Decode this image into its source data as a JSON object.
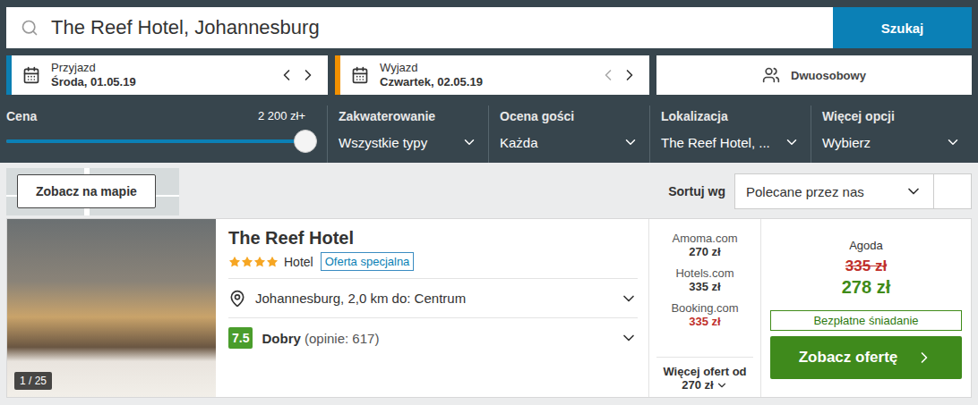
{
  "search": {
    "query": "The Reef Hotel, Johannesburg",
    "button": "Szukaj"
  },
  "dates": [
    {
      "label": "Przyjazd",
      "value": "Środa, 01.05.19",
      "color": "#0b7fb3",
      "prev_disabled": false
    },
    {
      "label": "Wyjazd",
      "value": "Czwartek, 02.05.19",
      "color": "#f29100",
      "prev_disabled": true
    }
  ],
  "room": {
    "label": "Dwuosobowy"
  },
  "price_filter": {
    "label": "Cena",
    "reading": "2 200 zł+",
    "level": 1
  },
  "filters": [
    {
      "label": "Zakwaterowanie",
      "value": "Wszystkie typy"
    },
    {
      "label": "Ocena gości",
      "value": "Każda"
    },
    {
      "label": "Lokalizacja",
      "value": "The Reef Hotel, ..."
    },
    {
      "label": "Więcej opcji",
      "value": "Wybierz"
    }
  ],
  "map_button": "Zobacz na mapie",
  "sort": {
    "label": "Sortuj wg",
    "value": "Polecane przez nas"
  },
  "hotel": {
    "name": "The Reef Hotel",
    "stars": 4,
    "type": "Hotel",
    "badge": "Oferta specjalna",
    "photo_counter": "1 / 25",
    "location": "Johannesburg, 2,0 km do: Centrum",
    "rating": {
      "score": "7.5",
      "label": "Dobry",
      "reviews": "(opinie: 617)"
    },
    "offers": [
      {
        "site": "Amoma.com",
        "price": "270 zł",
        "color": "#333333"
      },
      {
        "site": "Hotels.com",
        "price": "335 zł",
        "color": "#333333"
      },
      {
        "site": "Booking.com",
        "price": "335 zł",
        "color": "#c0302b"
      }
    ],
    "more_offers": {
      "label": "Więcej ofert od",
      "price": "270 zł"
    },
    "deal": {
      "site": "Agoda",
      "old_price": "335 zł",
      "price": "278 zł",
      "perk": "Bezpłatne śniadanie",
      "cta": "Zobacz ofertę"
    }
  }
}
